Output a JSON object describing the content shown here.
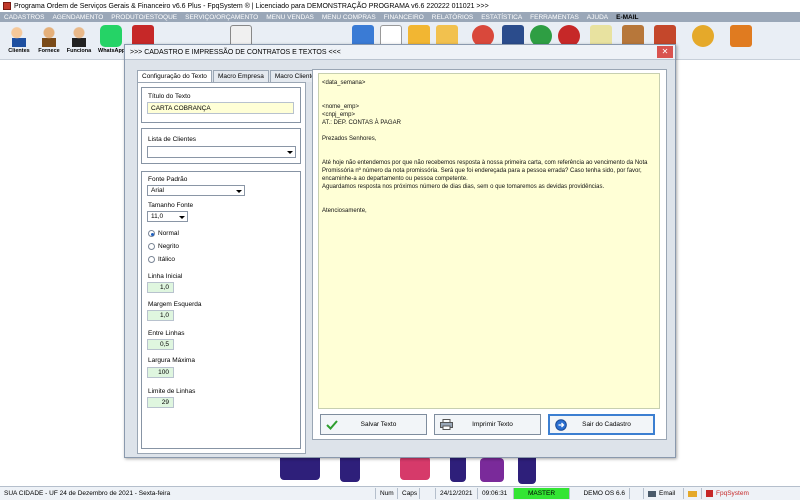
{
  "window": {
    "title": "Programa Ordem de Serviços Gerais & Financeiro v6.6 Plus - FpqSystem ® | Licenciado para  DEMONSTRAÇÃO PROGRAMA v6.6 220222 011021 >>>"
  },
  "menu": {
    "items": [
      "CADASTROS",
      "AGENDAMENTO",
      "PRODUTO/ESTOQUE",
      "SERVIÇO/ORÇAMENTO",
      "MENU VENDAS",
      "MENU COMPRAS",
      "FINANCEIRO",
      "RELATÓRIOS",
      "ESTATÍSTICA",
      "FERRAMENTAS",
      "AJUDA",
      "E-MAIL"
    ]
  },
  "toolbar": {
    "labels": [
      "Clientes",
      "Fornece",
      "Funciona",
      "WhatsApp"
    ]
  },
  "dialog": {
    "title": ">>> CADASTRO E IMPRESSÃO DE CONTRATOS E TEXTOS <<<",
    "tabs": [
      "Configuração do Texto",
      "Macro Empresa",
      "Macro Cliente"
    ],
    "form": {
      "titulo_label": "Título do Texto",
      "titulo_value": "CARTA COBRANÇA",
      "lista_label": "Lista de Clientes",
      "lista_value": "",
      "fonte_label": "Fonte Padrão",
      "fonte_value": "Arial",
      "tamanho_label": "Tamanho Fonte",
      "tamanho_value": "11,0",
      "styles": [
        "Normal",
        "Negrito",
        "Itálico"
      ],
      "linha_inicial_label": "Linha Inicial",
      "linha_inicial_value": "1,0",
      "margem_label": "Margem Esquerda",
      "margem_value": "1,0",
      "entre_linhas_label": "Entre Linhas",
      "entre_linhas_value": "0,5",
      "largura_label": "Largura Máxima",
      "largura_value": "100",
      "limite_label": "Limite de Linhas",
      "limite_value": "29"
    },
    "editor": {
      "lines": [
        "<data_semana>",
        "",
        "",
        "<nome_emp>",
        "<cnpj_emp>",
        "AT.: DEP. CONTAS À PAGAR",
        "",
        "Prezados Senhores,",
        "",
        "",
        "Até hoje não entendemos por que não recebemos resposta à nossa primeira carta, com referência ao vencimento da Nota",
        "Promissória nº número da nota promissória. Será que foi endereçada para a pessoa errada? Caso tenha sido, por favor,",
        "encaminhe-a ao departamento ou pessoa competente.",
        "Aguardamos resposta nos próximos número de dias dias, sem o que tomaremos as devidas providências.",
        "",
        "",
        "Atenciosamente,"
      ]
    },
    "buttons": {
      "save": "Salvar Texto",
      "print": "Imprimir Texto",
      "exit": "Sair do Cadastro"
    }
  },
  "status": {
    "city": "SUA CIDADE - UF 24 de Dezembro de 2021 - Sexta-feira",
    "num": "Num",
    "caps": "Caps",
    "date": "24/12/2021",
    "time": "09:06:31",
    "mode": "MASTER",
    "os": "DEMO OS 6.6",
    "email": "Email",
    "brand": "FpqSystem"
  }
}
